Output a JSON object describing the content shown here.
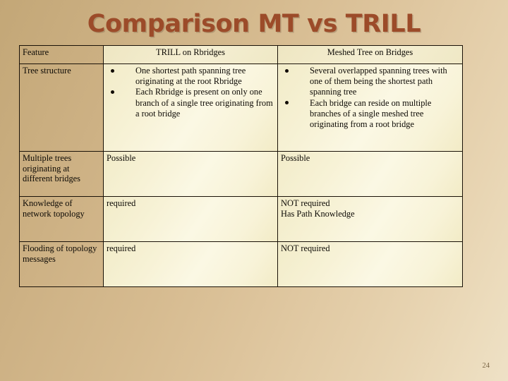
{
  "slide": {
    "title": "Comparison MT vs TRILL",
    "page_number": "24",
    "accent_color": "#9c4b29",
    "background_color": "#d6bb90",
    "border_color": "#1a1208"
  },
  "table": {
    "headers": {
      "feature": "Feature",
      "trill": "TRILL on Rbridges",
      "mt": "Meshed Tree on Bridges"
    },
    "rows": [
      {
        "feature": "Tree structure",
        "trill_bullets": [
          "One shortest path spanning tree originating at the root Rbridge",
          "Each Rbridge is present on only one branch of a single tree originating from a root bridge"
        ],
        "mt_bullets": [
          "Several overlapped spanning trees with one of them being the shortest path spanning tree",
          "Each bridge can reside on multiple branches of a single meshed tree originating from a root bridge"
        ]
      },
      {
        "feature": "Multiple trees originating at different bridges",
        "trill_lines": [
          "Possible"
        ],
        "mt_lines": [
          "Possible"
        ]
      },
      {
        "feature": "Knowledge of network topology",
        "trill_lines": [
          "required"
        ],
        "mt_lines": [
          "NOT required",
          "Has Path Knowledge"
        ]
      },
      {
        "feature": "Flooding of topology messages",
        "trill_lines": [
          "required"
        ],
        "mt_lines": [
          "NOT required"
        ]
      }
    ]
  }
}
